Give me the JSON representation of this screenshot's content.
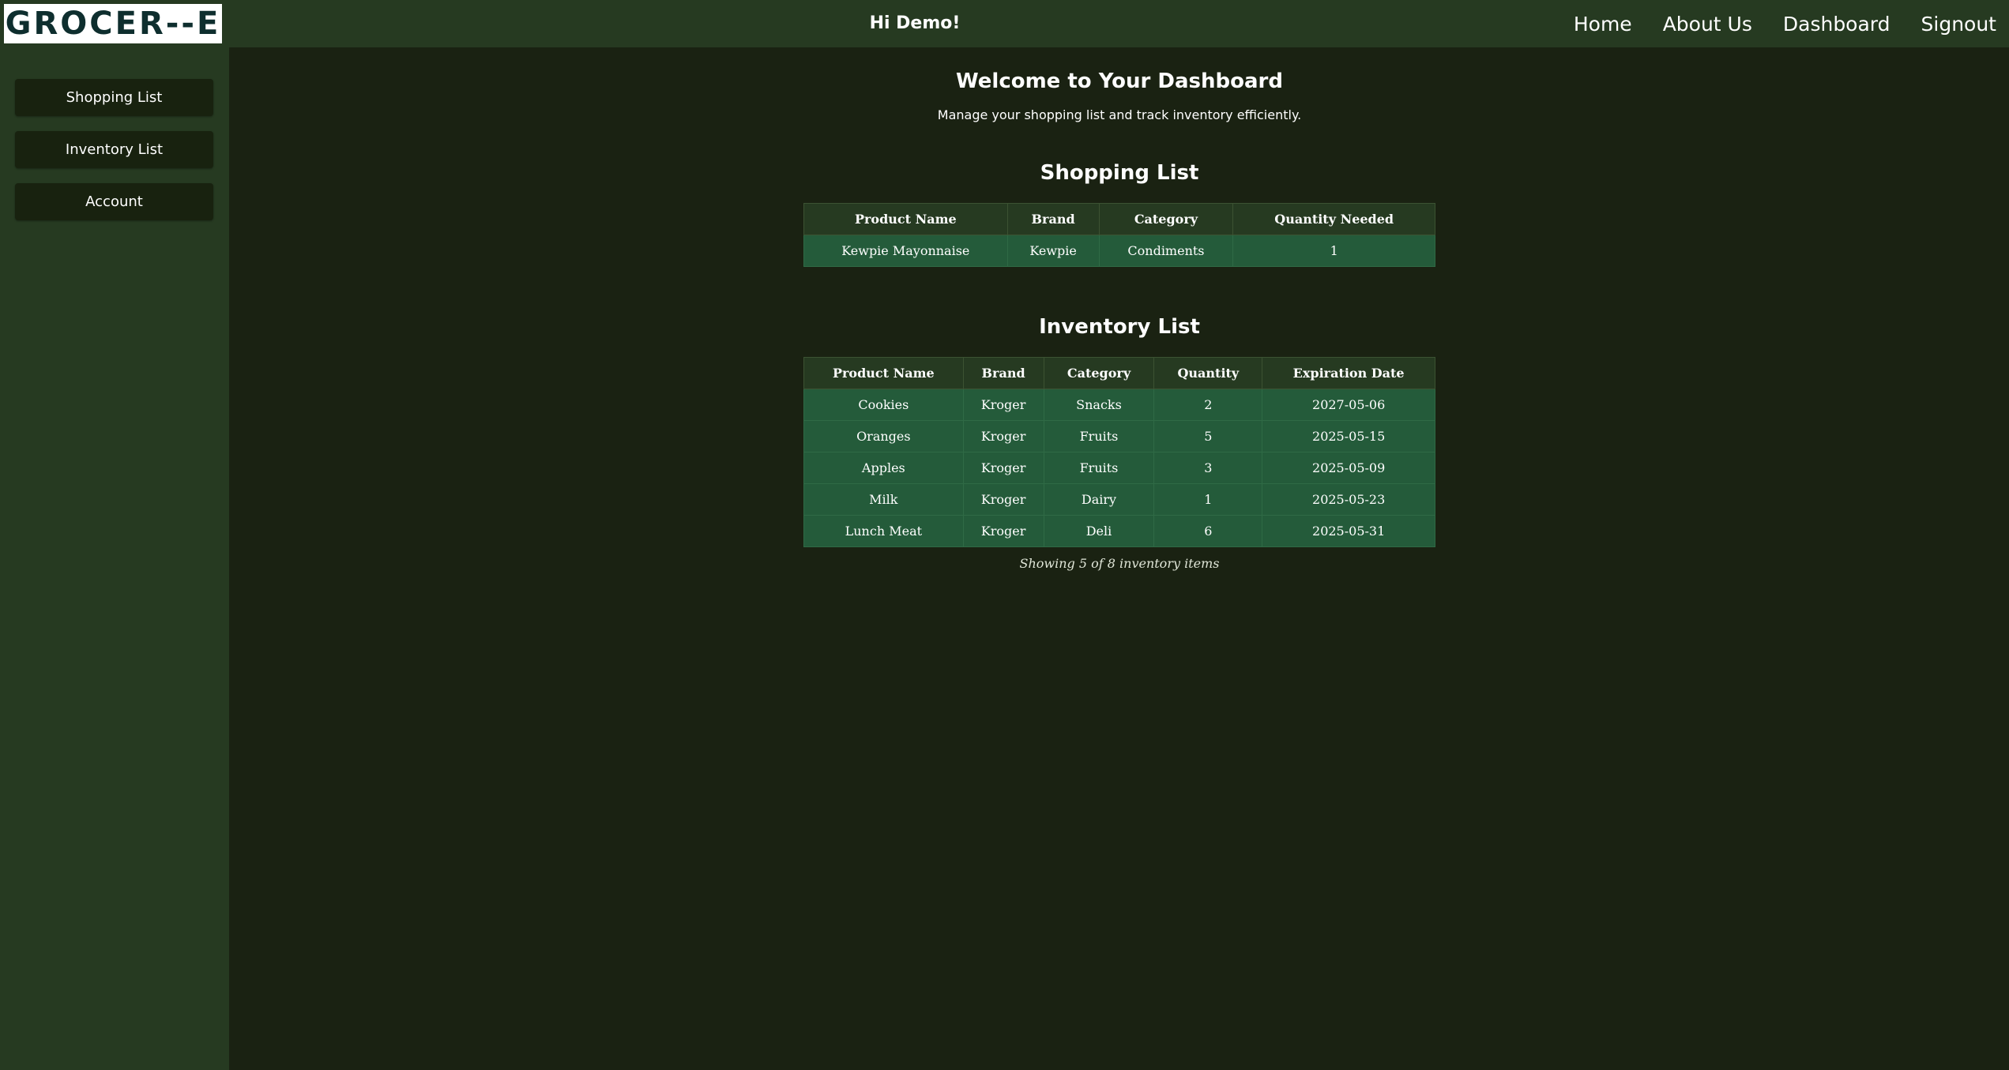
{
  "header": {
    "logo_text": "GROCER--E",
    "greeting": "Hi Demo!",
    "nav": [
      "Home",
      "About Us",
      "Dashboard",
      "Signout"
    ]
  },
  "sidebar": {
    "items": [
      "Shopping List",
      "Inventory List",
      "Account"
    ]
  },
  "main": {
    "title": "Welcome to Your Dashboard",
    "subtitle": "Manage your shopping list and track inventory efficiently.",
    "shopping": {
      "title": "Shopping List",
      "columns": [
        "Product Name",
        "Brand",
        "Category",
        "Quantity Needed"
      ],
      "rows": [
        [
          "Kewpie Mayonnaise",
          "Kewpie",
          "Condiments",
          "1"
        ]
      ]
    },
    "inventory": {
      "title": "Inventory List",
      "columns": [
        "Product Name",
        "Brand",
        "Category",
        "Quantity",
        "Expiration Date"
      ],
      "rows": [
        [
          "Cookies",
          "Kroger",
          "Snacks",
          "2",
          "2027-05-06"
        ],
        [
          "Oranges",
          "Kroger",
          "Fruits",
          "5",
          "2025-05-15"
        ],
        [
          "Apples",
          "Kroger",
          "Fruits",
          "3",
          "2025-05-09"
        ],
        [
          "Milk",
          "Kroger",
          "Dairy",
          "1",
          "2025-05-23"
        ],
        [
          "Lunch Meat",
          "Kroger",
          "Deli",
          "6",
          "2025-05-31"
        ]
      ],
      "footnote": "Showing 5 of 8 inventory items"
    }
  },
  "colors": {
    "header_bg": "#263a21",
    "page_bg": "#1a2212",
    "row_bg": "#245b3a",
    "logo_text": "#0e2e2e"
  }
}
